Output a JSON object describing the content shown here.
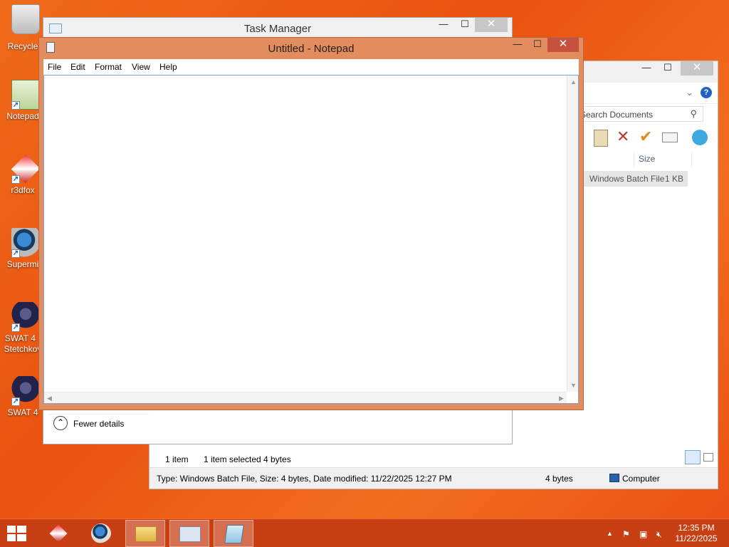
{
  "desktop": {
    "icons": [
      {
        "label": "Recycle"
      },
      {
        "label": "Notepad"
      },
      {
        "label": "r3dfox"
      },
      {
        "label": "Supermi"
      },
      {
        "label": "SWAT 4 -\nStetchkov"
      },
      {
        "label": "SWAT 4"
      }
    ]
  },
  "task_manager": {
    "title": "Task Manager",
    "fewer_details": "Fewer details",
    "buttons": {
      "minimize": "—",
      "maximize": "☐",
      "close": "✕"
    }
  },
  "explorer": {
    "search_placeholder": "Search Documents",
    "column_size": "Size",
    "row": {
      "type": "Windows Batch File",
      "size": "1 KB"
    },
    "status": {
      "items": "1 item",
      "selected": "1 item selected",
      "bytes": "4 bytes"
    },
    "details_bar": {
      "text": "Type: Windows Batch File, Size: 4 bytes, Date modified: 11/22/2025 12:27 PM",
      "size": "4 bytes",
      "location": "Computer"
    },
    "buttons": {
      "minimize": "—",
      "maximize": "☐",
      "close": "✕"
    }
  },
  "notepad": {
    "title": "Untitled - Notepad",
    "menu": [
      "File",
      "Edit",
      "Format",
      "View",
      "Help"
    ],
    "content": "",
    "buttons": {
      "minimize": "—",
      "maximize": "☐",
      "close": "✕"
    }
  },
  "taskbar": {
    "clock_time": "12:35 PM",
    "clock_date": "11/22/2025"
  },
  "colors": {
    "desktop": "#ec5d16",
    "notepad_frame": "#e38c5e",
    "taskbar": "#c83f14"
  }
}
